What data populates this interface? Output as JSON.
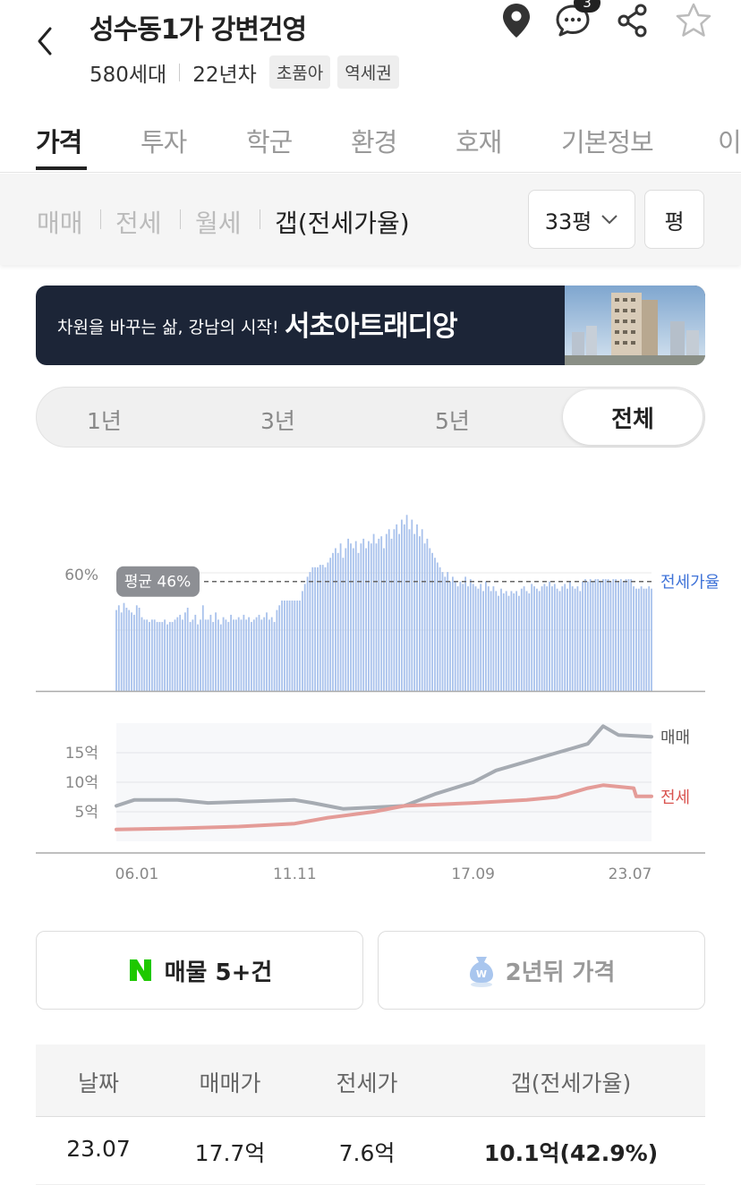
{
  "header": {
    "title": "성수동1가 강변건영",
    "households": "580세대",
    "age": "22년차",
    "tags": [
      "초품아",
      "역세권"
    ],
    "comment_count": "3",
    "icons": [
      "back-arrow-icon",
      "location-pin-icon",
      "comment-icon",
      "share-icon",
      "star-icon"
    ]
  },
  "tabs": [
    "가격",
    "투자",
    "학군",
    "환경",
    "호재",
    "기본정보",
    "이"
  ],
  "active_tab": "가격",
  "trade_types": [
    "매매",
    "전세",
    "월세",
    "갭(전세가율)"
  ],
  "active_trade_type": "갭(전세가율)",
  "size_select": {
    "value": "33평"
  },
  "unit_button": "평",
  "banner": {
    "text": "차원을 바꾸는 삶, 강남의 시작!",
    "brand": "서초아트래디앙"
  },
  "periods": [
    "1년",
    "3년",
    "5년",
    "전체"
  ],
  "active_period": "전체",
  "chart_data": [
    {
      "type": "bar",
      "ylabel_tick": "60%",
      "average_label": "평균 46%",
      "average": 46,
      "series_label": "전세가율",
      "ylim": [
        0,
        76
      ],
      "x_range": [
        "2006.01",
        "2023.07"
      ],
      "points_per_period": "monthly",
      "values_by_year": {
        "2006": [
          34,
          36,
          33,
          37,
          35,
          34,
          33,
          32,
          36,
          35,
          31,
          30
        ],
        "2007": [
          30,
          29,
          30,
          30,
          29,
          29,
          29,
          30,
          28,
          29,
          29,
          30
        ],
        "2008": [
          31,
          32,
          30,
          33,
          35,
          29,
          30,
          32,
          28,
          30,
          36,
          30
        ],
        "2009": [
          30,
          32,
          29,
          33,
          30,
          28,
          31,
          30,
          29,
          32,
          30,
          30
        ],
        "2010": [
          31,
          30,
          32,
          30,
          31,
          29,
          30,
          31,
          32,
          30,
          31,
          33
        ],
        "2011": [
          30,
          31,
          29,
          34,
          36,
          38,
          38,
          38,
          38,
          38,
          38,
          38
        ],
        "2012": [
          38,
          42,
          45,
          48,
          50,
          52,
          52,
          52,
          53,
          53,
          52,
          54
        ],
        "2013": [
          56,
          58,
          60,
          58,
          62,
          56,
          60,
          64,
          62,
          60,
          63,
          58
        ],
        "2014": [
          62,
          64,
          60,
          63,
          62,
          66,
          62,
          64,
          65,
          60,
          66,
          68
        ],
        "2015": [
          64,
          68,
          70,
          66,
          72,
          70,
          74,
          68,
          72,
          66,
          70,
          65
        ],
        "2016": [
          68,
          62,
          64,
          60,
          58,
          56,
          54,
          52,
          50,
          48,
          50,
          46
        ],
        "2017": [
          48,
          46,
          44,
          46,
          45,
          48,
          44,
          47,
          45,
          44,
          43,
          45
        ],
        "2018": [
          42,
          46,
          44,
          42,
          44,
          42,
          40,
          43,
          41,
          42,
          40,
          42
        ],
        "2019": [
          41,
          42,
          40,
          43,
          44,
          42,
          41,
          45,
          44,
          43,
          42,
          44
        ],
        "2020": [
          45,
          44,
          46,
          44,
          45,
          43,
          42,
          44,
          45,
          43,
          46,
          44
        ],
        "2021": [
          43,
          44,
          42,
          46,
          47,
          46,
          47,
          46,
          47,
          47,
          46,
          47
        ],
        "2022": [
          47,
          47,
          46,
          47,
          47,
          46,
          47,
          46,
          47,
          47,
          47,
          44
        ],
        "2023": [
          43,
          43,
          44,
          43,
          43,
          44,
          43
        ]
      }
    },
    {
      "type": "line",
      "yticks": [
        "15억",
        "10억",
        "5억"
      ],
      "ytick_values": [
        15,
        10,
        5
      ],
      "ylim": [
        0,
        20
      ],
      "x_tick_labels": [
        "06.01",
        "11.11",
        "17.09",
        "23.07"
      ],
      "series": [
        {
          "name": "매매",
          "color": "#a6abb2",
          "points": [
            [
              "2006.01",
              6
            ],
            [
              "2006.08",
              7
            ],
            [
              "2008.01",
              7
            ],
            [
              "2009.01",
              6.5
            ],
            [
              "2011.11",
              7
            ],
            [
              "2012.06",
              6.5
            ],
            [
              "2013.06",
              5.5
            ],
            [
              "2015.06",
              6
            ],
            [
              "2016.06",
              8
            ],
            [
              "2017.09",
              10
            ],
            [
              "2018.06",
              12
            ],
            [
              "2019.06",
              13.5
            ],
            [
              "2020.06",
              15
            ],
            [
              "2021.06",
              16.5
            ],
            [
              "2021.12",
              19.5
            ],
            [
              "2022.06",
              18
            ],
            [
              "2023.07",
              17.7
            ]
          ]
        },
        {
          "name": "전세",
          "color": "#e49c98",
          "points": [
            [
              "2006.01",
              2
            ],
            [
              "2008.01",
              2.2
            ],
            [
              "2010.01",
              2.5
            ],
            [
              "2011.11",
              3
            ],
            [
              "2012.12",
              4
            ],
            [
              "2014.06",
              5
            ],
            [
              "2015.06",
              6
            ],
            [
              "2017.09",
              6.5
            ],
            [
              "2019.06",
              7
            ],
            [
              "2020.06",
              7.5
            ],
            [
              "2021.06",
              9
            ],
            [
              "2021.12",
              9.5
            ],
            [
              "2022.12",
              9
            ],
            [
              "2023.01",
              7.6
            ],
            [
              "2023.07",
              7.6
            ]
          ]
        }
      ],
      "legend_labels": [
        "매매",
        "전세"
      ]
    }
  ],
  "action_buttons": {
    "listings": "매물 5+건",
    "future_price": "2년뒤 가격"
  },
  "table": {
    "headers": [
      "날짜",
      "매매가",
      "전세가",
      "갭(전세가율)"
    ],
    "rows": [
      [
        "23.07",
        "17.7억",
        "7.6억",
        "10.1억(42.9%)"
      ]
    ]
  },
  "colors": {
    "bars": "#a9c2ec",
    "jeonse_ratio_label": "#3f73d8",
    "jeonse_label": "#d9534f",
    "banner_bg": "#1c2537",
    "naver_green": "#1ec800"
  }
}
